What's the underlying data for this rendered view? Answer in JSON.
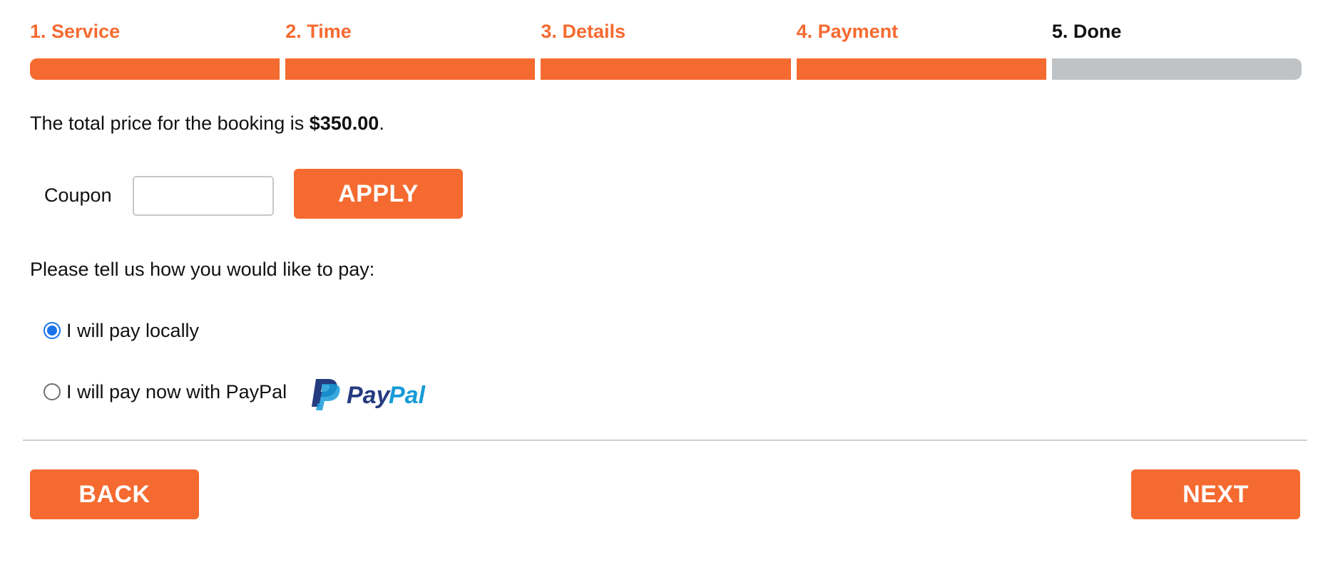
{
  "steps": [
    {
      "label": "1. Service",
      "completed": true
    },
    {
      "label": "2. Time",
      "completed": true
    },
    {
      "label": "3. Details",
      "completed": true
    },
    {
      "label": "4. Payment",
      "completed": true
    },
    {
      "label": "5. Done",
      "completed": false
    }
  ],
  "price": {
    "prefix": "The total price for the booking is ",
    "amount": "$350.00",
    "suffix": "."
  },
  "coupon": {
    "label": "Coupon",
    "value": "",
    "apply_label": "APPLY"
  },
  "payment": {
    "prompt": "Please tell us how you would like to pay:",
    "options": [
      {
        "label": "I will pay locally",
        "selected": true
      },
      {
        "label": "I will pay now with PayPal",
        "selected": false
      }
    ],
    "paypal_logo_text": "PayPal"
  },
  "nav": {
    "back_label": "BACK",
    "next_label": "NEXT"
  },
  "colors": {
    "accent": "#f56a30",
    "inactive_bar": "#bfc3c6",
    "radio_selected": "#1a73e8",
    "paypal_dark": "#253b80",
    "paypal_light": "#179bd7"
  },
  "icons": {
    "paypal": "paypal-logo-icon"
  }
}
